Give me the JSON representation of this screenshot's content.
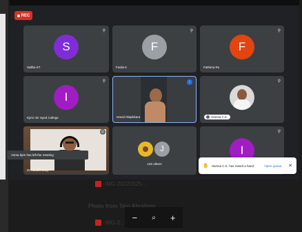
{
  "recording": {
    "label": "REC"
  },
  "tiles": [
    {
      "initial": "S",
      "name": "Saliha KT",
      "color": "#7f2dd6"
    },
    {
      "initial": "F",
      "name": "Fasila K",
      "color": "#9aa0a6"
    },
    {
      "initial": "F",
      "name": "Fathima Ru",
      "color": "#e2450f"
    },
    {
      "initial": "I",
      "name": "IQAC Sir Syed College",
      "color": "#a21cc4"
    },
    {
      "name": "Ismail Olayikkara"
    },
    {
      "name": "Hamsa C.K."
    },
    {
      "name": "Dr.Abdulla kutty"
    },
    {
      "label": "125 others"
    },
    {
      "initial": "I",
      "color": "#a21cc4"
    }
  ],
  "notifications": {
    "left_meeting": "Asma kpm has left the meeting",
    "raised_hand": "Hamsa C.K. has raised a hand",
    "open_queue": "Open queue"
  },
  "background_page": {
    "file1": "IMG-20220325-...",
    "photo_from": "Photo from Tejo Abraham",
    "file2": "IMG-2..."
  },
  "zoom_controls": {
    "minus": "−",
    "zoom": "🔍",
    "plus": "+"
  }
}
